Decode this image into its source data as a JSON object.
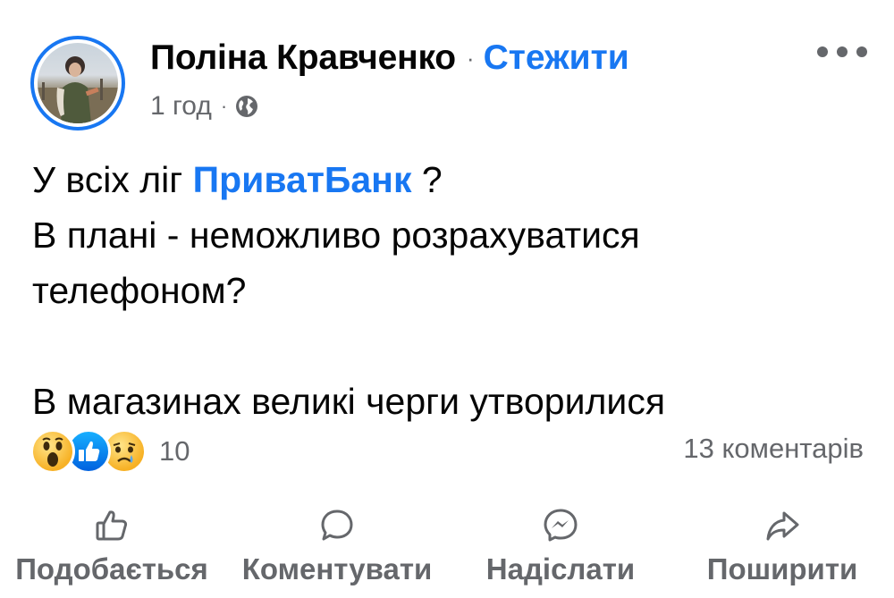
{
  "post": {
    "author": "Поліна Кравченко",
    "separator": "·",
    "follow_label": "Стежити",
    "time": "1 год",
    "meta_separator": "·",
    "privacy_icon": "globe-icon",
    "text": {
      "line1_prefix": "У всіх ліг ",
      "line1_link": "ПриватБанк",
      "line1_suffix": " ?",
      "line2": "В плані - неможливо розрахуватися",
      "line3": "телефоном?",
      "line4": "В магазинах великі черги утворилися"
    },
    "reactions": {
      "icons": [
        "wow-icon",
        "like-icon",
        "sad-icon"
      ],
      "count": "10"
    },
    "comments": "13 коментарів",
    "actions": {
      "like": "Подобається",
      "comment": "Коментувати",
      "send": "Надіслати",
      "share": "Поширити"
    }
  },
  "colors": {
    "accent": "#1877f2",
    "secondary_text": "#65676b",
    "primary_text": "#050505"
  }
}
